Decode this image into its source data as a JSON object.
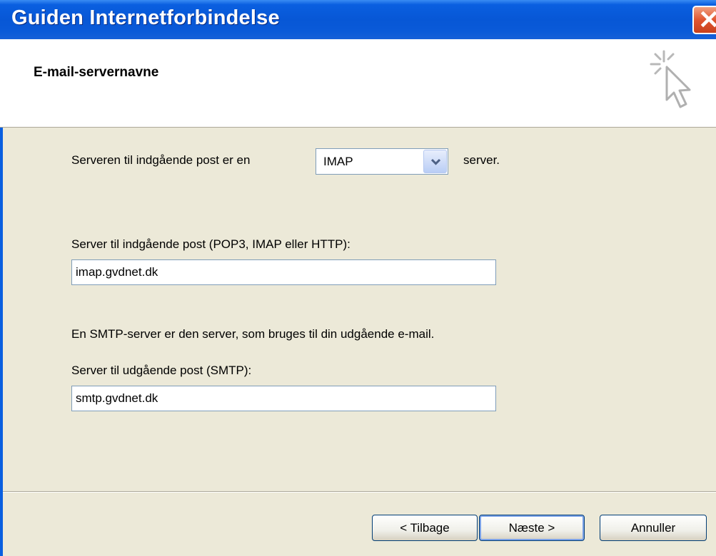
{
  "window": {
    "title": "Guiden Internetforbindelse",
    "close_icon": "close-icon"
  },
  "header": {
    "title": "E-mail-servernavne",
    "icon": "wizard-cursor-icon"
  },
  "form": {
    "incoming_type_label": "Serveren til indgående post er en",
    "incoming_type_value": "IMAP",
    "incoming_type_suffix": "server.",
    "incoming_server_label": "Server til indgående post (POP3, IMAP eller HTTP):",
    "incoming_server_value": "imap.gvdnet.dk",
    "smtp_info": "En SMTP-server er den server, som bruges til din udgående e-mail.",
    "outgoing_server_label": "Server til udgående post (SMTP):",
    "outgoing_server_value": "smtp.gvdnet.dk"
  },
  "buttons": {
    "back": "< Tilbage",
    "next": "Næste >",
    "cancel": "Annuller"
  },
  "colors": {
    "titlebar": "#0a5fe0",
    "dialog_bg": "#ece9d8",
    "close": "#e05530"
  }
}
